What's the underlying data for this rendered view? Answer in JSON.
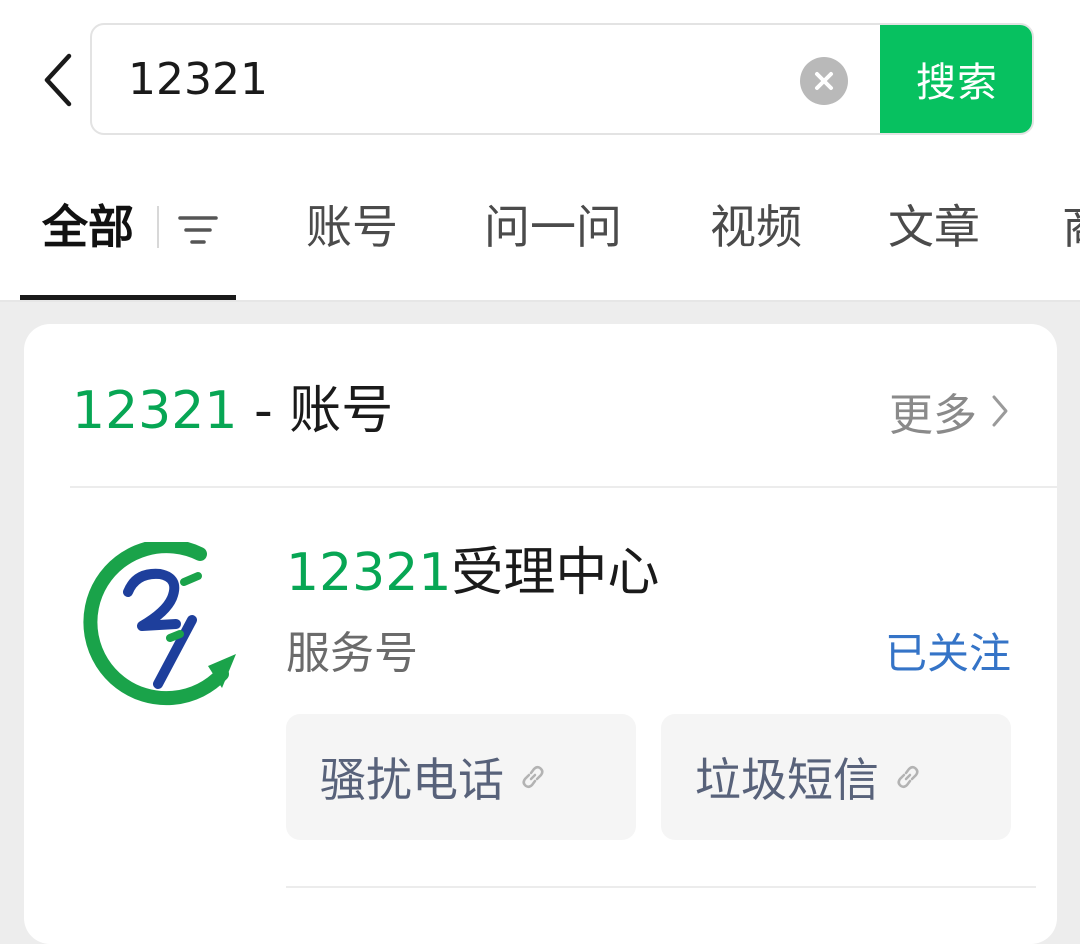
{
  "search": {
    "query": "12321",
    "button_label": "搜索"
  },
  "tabs": [
    {
      "label": "全部",
      "active": true
    },
    {
      "label": "账号"
    },
    {
      "label": "问一问"
    },
    {
      "label": "视频"
    },
    {
      "label": "文章"
    },
    {
      "label": "商"
    }
  ],
  "section": {
    "title_keyword": "12321",
    "title_suffix": " - 账号",
    "more_label": "更多"
  },
  "account": {
    "name_keyword": "12321",
    "name_rest": "受理中心",
    "type_label": "服务号",
    "follow_status": "已关注",
    "avatar_text": "2/1",
    "links": [
      {
        "label": "骚扰电话"
      },
      {
        "label": "垃圾短信"
      }
    ]
  },
  "colors": {
    "accent_green": "#07c160",
    "keyword_green": "#07a654",
    "link_blue": "#3574c7",
    "avatar_blue": "#1e3f9c"
  }
}
